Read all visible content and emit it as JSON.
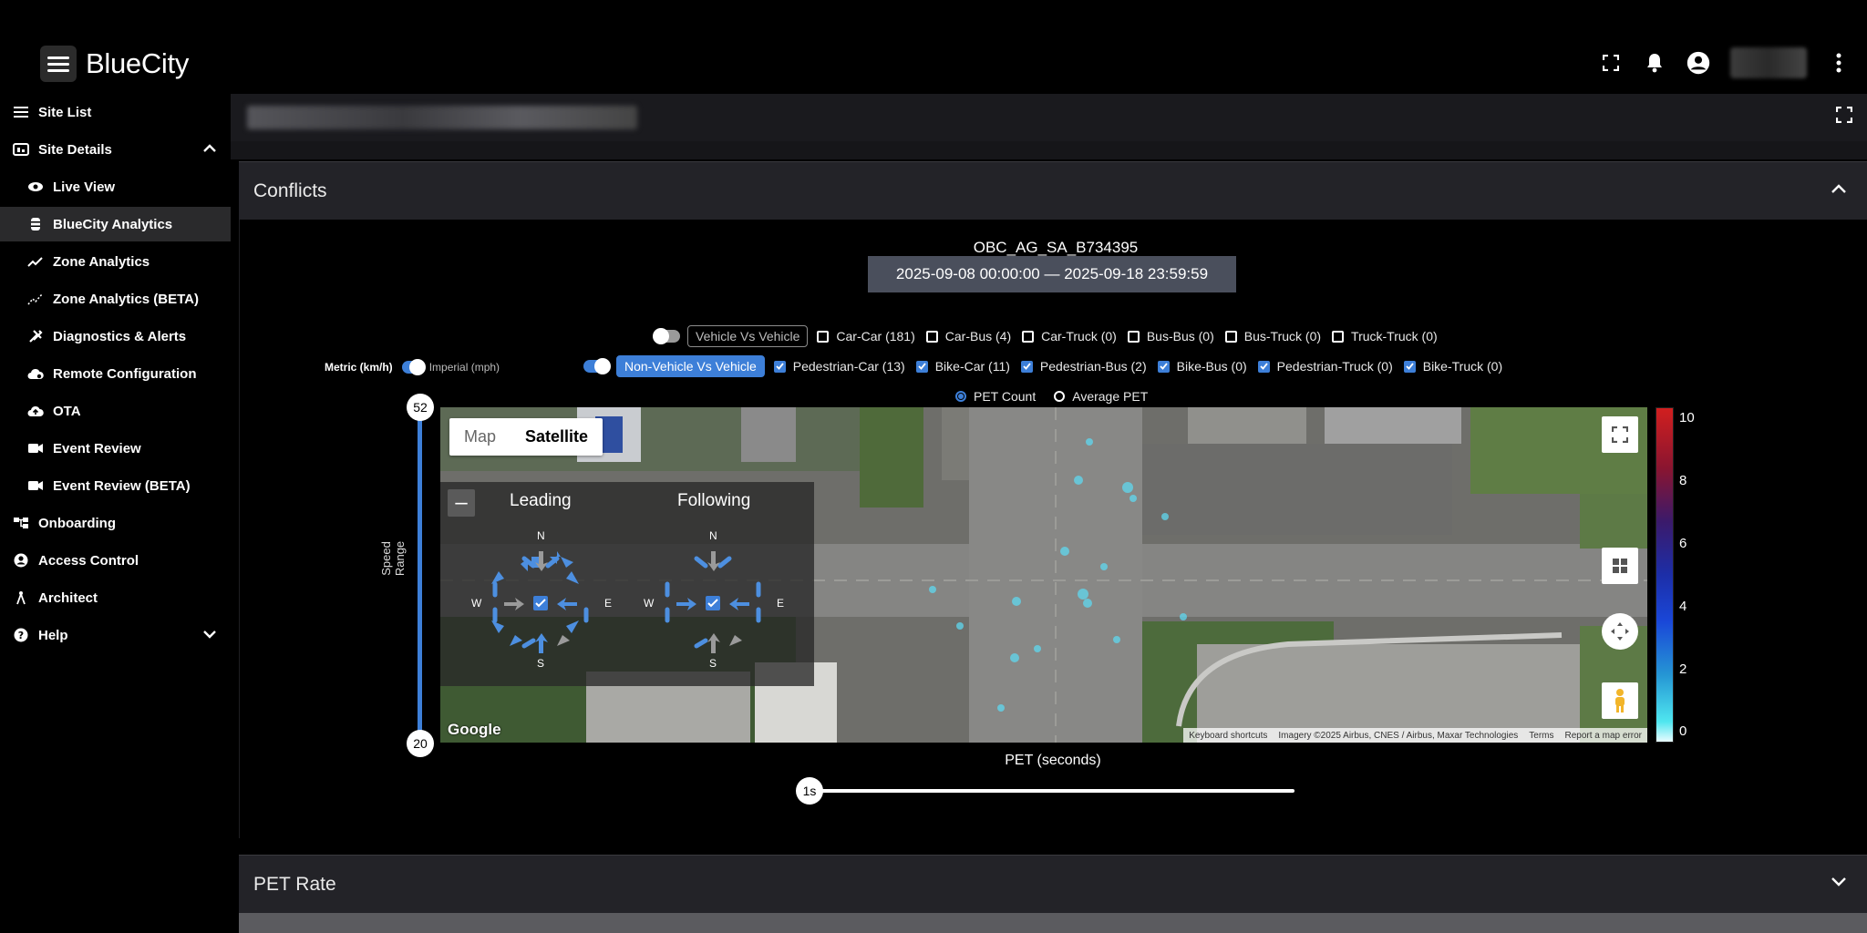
{
  "brand": {
    "name": "BlueCity"
  },
  "sidebar": {
    "items": [
      {
        "label": "Site List",
        "icon": "menu-icon"
      },
      {
        "label": "Site Details",
        "icon": "dashboard-icon"
      },
      {
        "label": "Live View",
        "icon": "eye-icon"
      },
      {
        "label": "BlueCity Analytics",
        "icon": "database-icon"
      },
      {
        "label": "Zone Analytics",
        "icon": "trend-icon"
      },
      {
        "label": "Zone Analytics (BETA)",
        "icon": "scatter-icon"
      },
      {
        "label": "Diagnostics & Alerts",
        "icon": "tools-icon"
      },
      {
        "label": "Remote Configuration",
        "icon": "cloud-settings-icon"
      },
      {
        "label": "OTA",
        "icon": "cloud-upload-icon"
      },
      {
        "label": "Event Review",
        "icon": "video-icon"
      },
      {
        "label": "Event Review (BETA)",
        "icon": "video-icon"
      },
      {
        "label": "Onboarding",
        "icon": "hierarchy-icon"
      },
      {
        "label": "Access Control",
        "icon": "account-icon"
      },
      {
        "label": "Architect",
        "icon": "compass-icon"
      },
      {
        "label": "Help",
        "icon": "help-icon"
      }
    ]
  },
  "panels": {
    "conflicts_title": "Conflicts",
    "pet_rate_title": "PET Rate"
  },
  "conflicts": {
    "site_id": "OBC_AG_SA_B734395",
    "date_range": "2025-09-08 00:00:00 — 2025-09-18 23:59:59",
    "vehicle_group": {
      "label": "Vehicle Vs Vehicle",
      "enabled": false,
      "options": [
        "Car-Car (181)",
        "Car-Bus (4)",
        "Car-Truck (0)",
        "Bus-Bus (0)",
        "Bus-Truck (0)",
        "Truck-Truck (0)"
      ]
    },
    "nonvehicle_group": {
      "label": "Non-Vehicle Vs Vehicle",
      "enabled": true,
      "options": [
        "Pedestrian-Car (13)",
        "Bike-Car (11)",
        "Pedestrian-Bus (2)",
        "Bike-Bus (0)",
        "Pedestrian-Truck (0)",
        "Bike-Truck (0)"
      ]
    },
    "units": {
      "metric": "Metric (km/h)",
      "imperial": "Imperial (mph)"
    },
    "metric_options": [
      "PET Count",
      "Average PET"
    ],
    "selected_metric": "PET Count",
    "speed": {
      "label": "Speed Range",
      "max": "52",
      "min": "20"
    },
    "map": {
      "type_options": [
        "Map",
        "Satellite"
      ],
      "selected_type": "Satellite",
      "leading": "Leading",
      "following": "Following",
      "compass": {
        "n": "N",
        "s": "S",
        "e": "E",
        "w": "W"
      },
      "google": "Google",
      "attribution": [
        "Keyboard shortcuts",
        "Imagery ©2025 Airbus, CNES / Airbus, Maxar Technologies",
        "Terms",
        "Report a map error"
      ]
    },
    "colorbar": {
      "ticks": [
        "10",
        "8",
        "6",
        "4",
        "2",
        "0"
      ],
      "colors": [
        "#d11f1f",
        "#1c2ea8",
        "#4fe6ef"
      ]
    },
    "pet": {
      "label": "PET (seconds)",
      "value": "1s"
    }
  },
  "colors": {
    "accent": "#3d7fd8",
    "panel_header": "#232328"
  }
}
